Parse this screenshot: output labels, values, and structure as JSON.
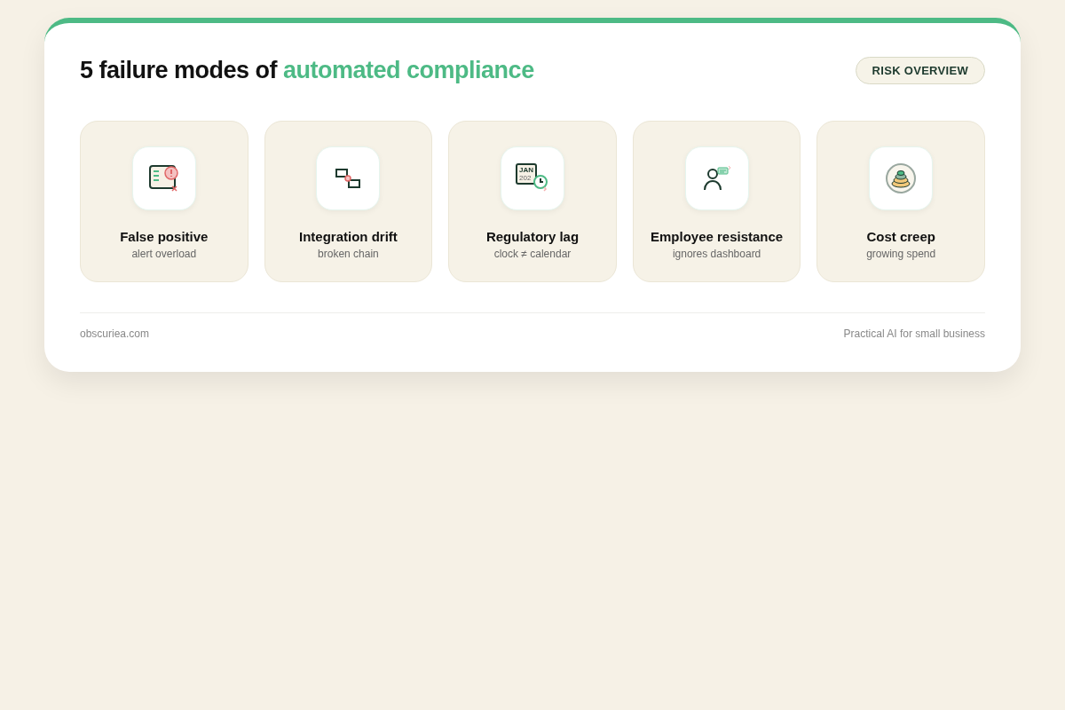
{
  "title": {
    "lead": "5 failure modes of",
    "accent": "automated compliance"
  },
  "badge": "RISK OVERVIEW",
  "cards": [
    {
      "kind": "alert",
      "title": "False positive",
      "subtitle": "alert overload"
    },
    {
      "kind": "chain",
      "title": "Integration drift",
      "subtitle": "broken chain"
    },
    {
      "kind": "calendar",
      "title": "Regulatory lag",
      "subtitle": "clock ≠ calendar",
      "icon_lines": [
        "JAN",
        "202"
      ]
    },
    {
      "kind": "person",
      "title": "Employee resistance",
      "subtitle": "ignores dashboard"
    },
    {
      "kind": "coins",
      "title": "Cost creep",
      "subtitle": "growing spend"
    }
  ],
  "footer": {
    "left": "obscuriea.com",
    "right": "Practical AI for small business"
  }
}
